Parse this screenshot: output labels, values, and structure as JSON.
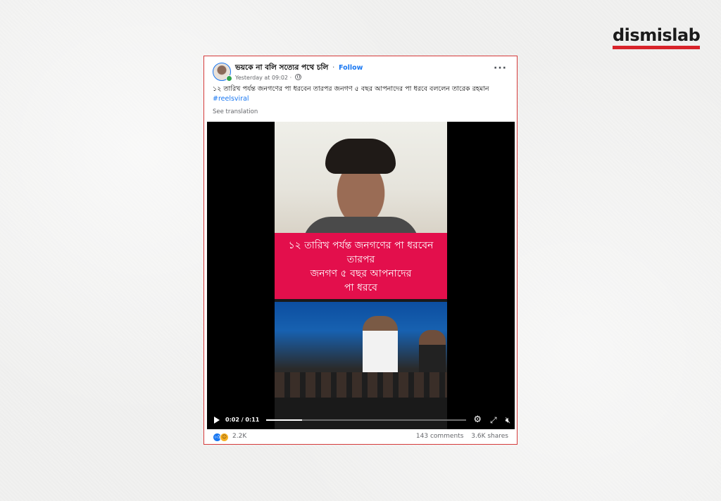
{
  "brand": {
    "name": "dismislab",
    "accent": "#d8232a"
  },
  "post": {
    "page_name": "ভয়কে না বলি সত্যের পথে চলি",
    "follow_label": "Follow",
    "separator": "·",
    "timestamp": "Yesterday at 09:02",
    "timestamp_sep": "·",
    "caption": "১২ তারিখ পর্যন্ত জনগণের পা ধরবেন তারপর জনগণ ৫ বছর আপনাদের পা ধরবে বললেন তারেক রহমান",
    "hashtag": "#reelsviral",
    "see_translation": "See translation",
    "more_icon": "more-options-icon"
  },
  "video": {
    "overlay_lines": [
      "১২ তারিখ পর্যন্ত জনগণের পা ধরবেন",
      "তারপর",
      "জনগণ ৫ বছর আপনাদের",
      "পা ধরবে"
    ],
    "overlay_color": "#e30f4c",
    "time_current": "0:02",
    "time_separator": "/",
    "time_total": "0:11",
    "progress_fraction": 0.18
  },
  "footer": {
    "reaction_count": "2.2K",
    "comments": "143 comments",
    "shares": "3.6K shares"
  }
}
